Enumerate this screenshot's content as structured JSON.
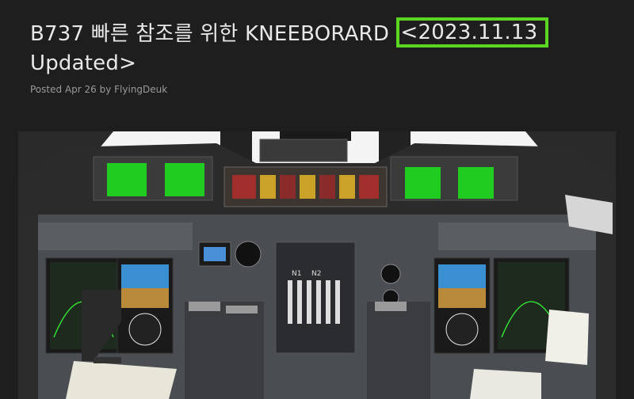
{
  "post": {
    "title_main": "B737 빠른 참조를 위한 KNEEBORARD ",
    "title_highlight": "<2023.11.13",
    "title_tail": "Updated>",
    "posted_label": "Posted",
    "date": "Apr 26",
    "by_label": "by",
    "author": "FlyingDeuk"
  },
  "image": {
    "subject": "cockpit-photo",
    "engine_labels": [
      "N1",
      "N2"
    ]
  },
  "colors": {
    "background": "#1e1e1f",
    "highlight": "#5bd622",
    "title": "#e8e8e8",
    "meta": "#8c8c8c"
  }
}
